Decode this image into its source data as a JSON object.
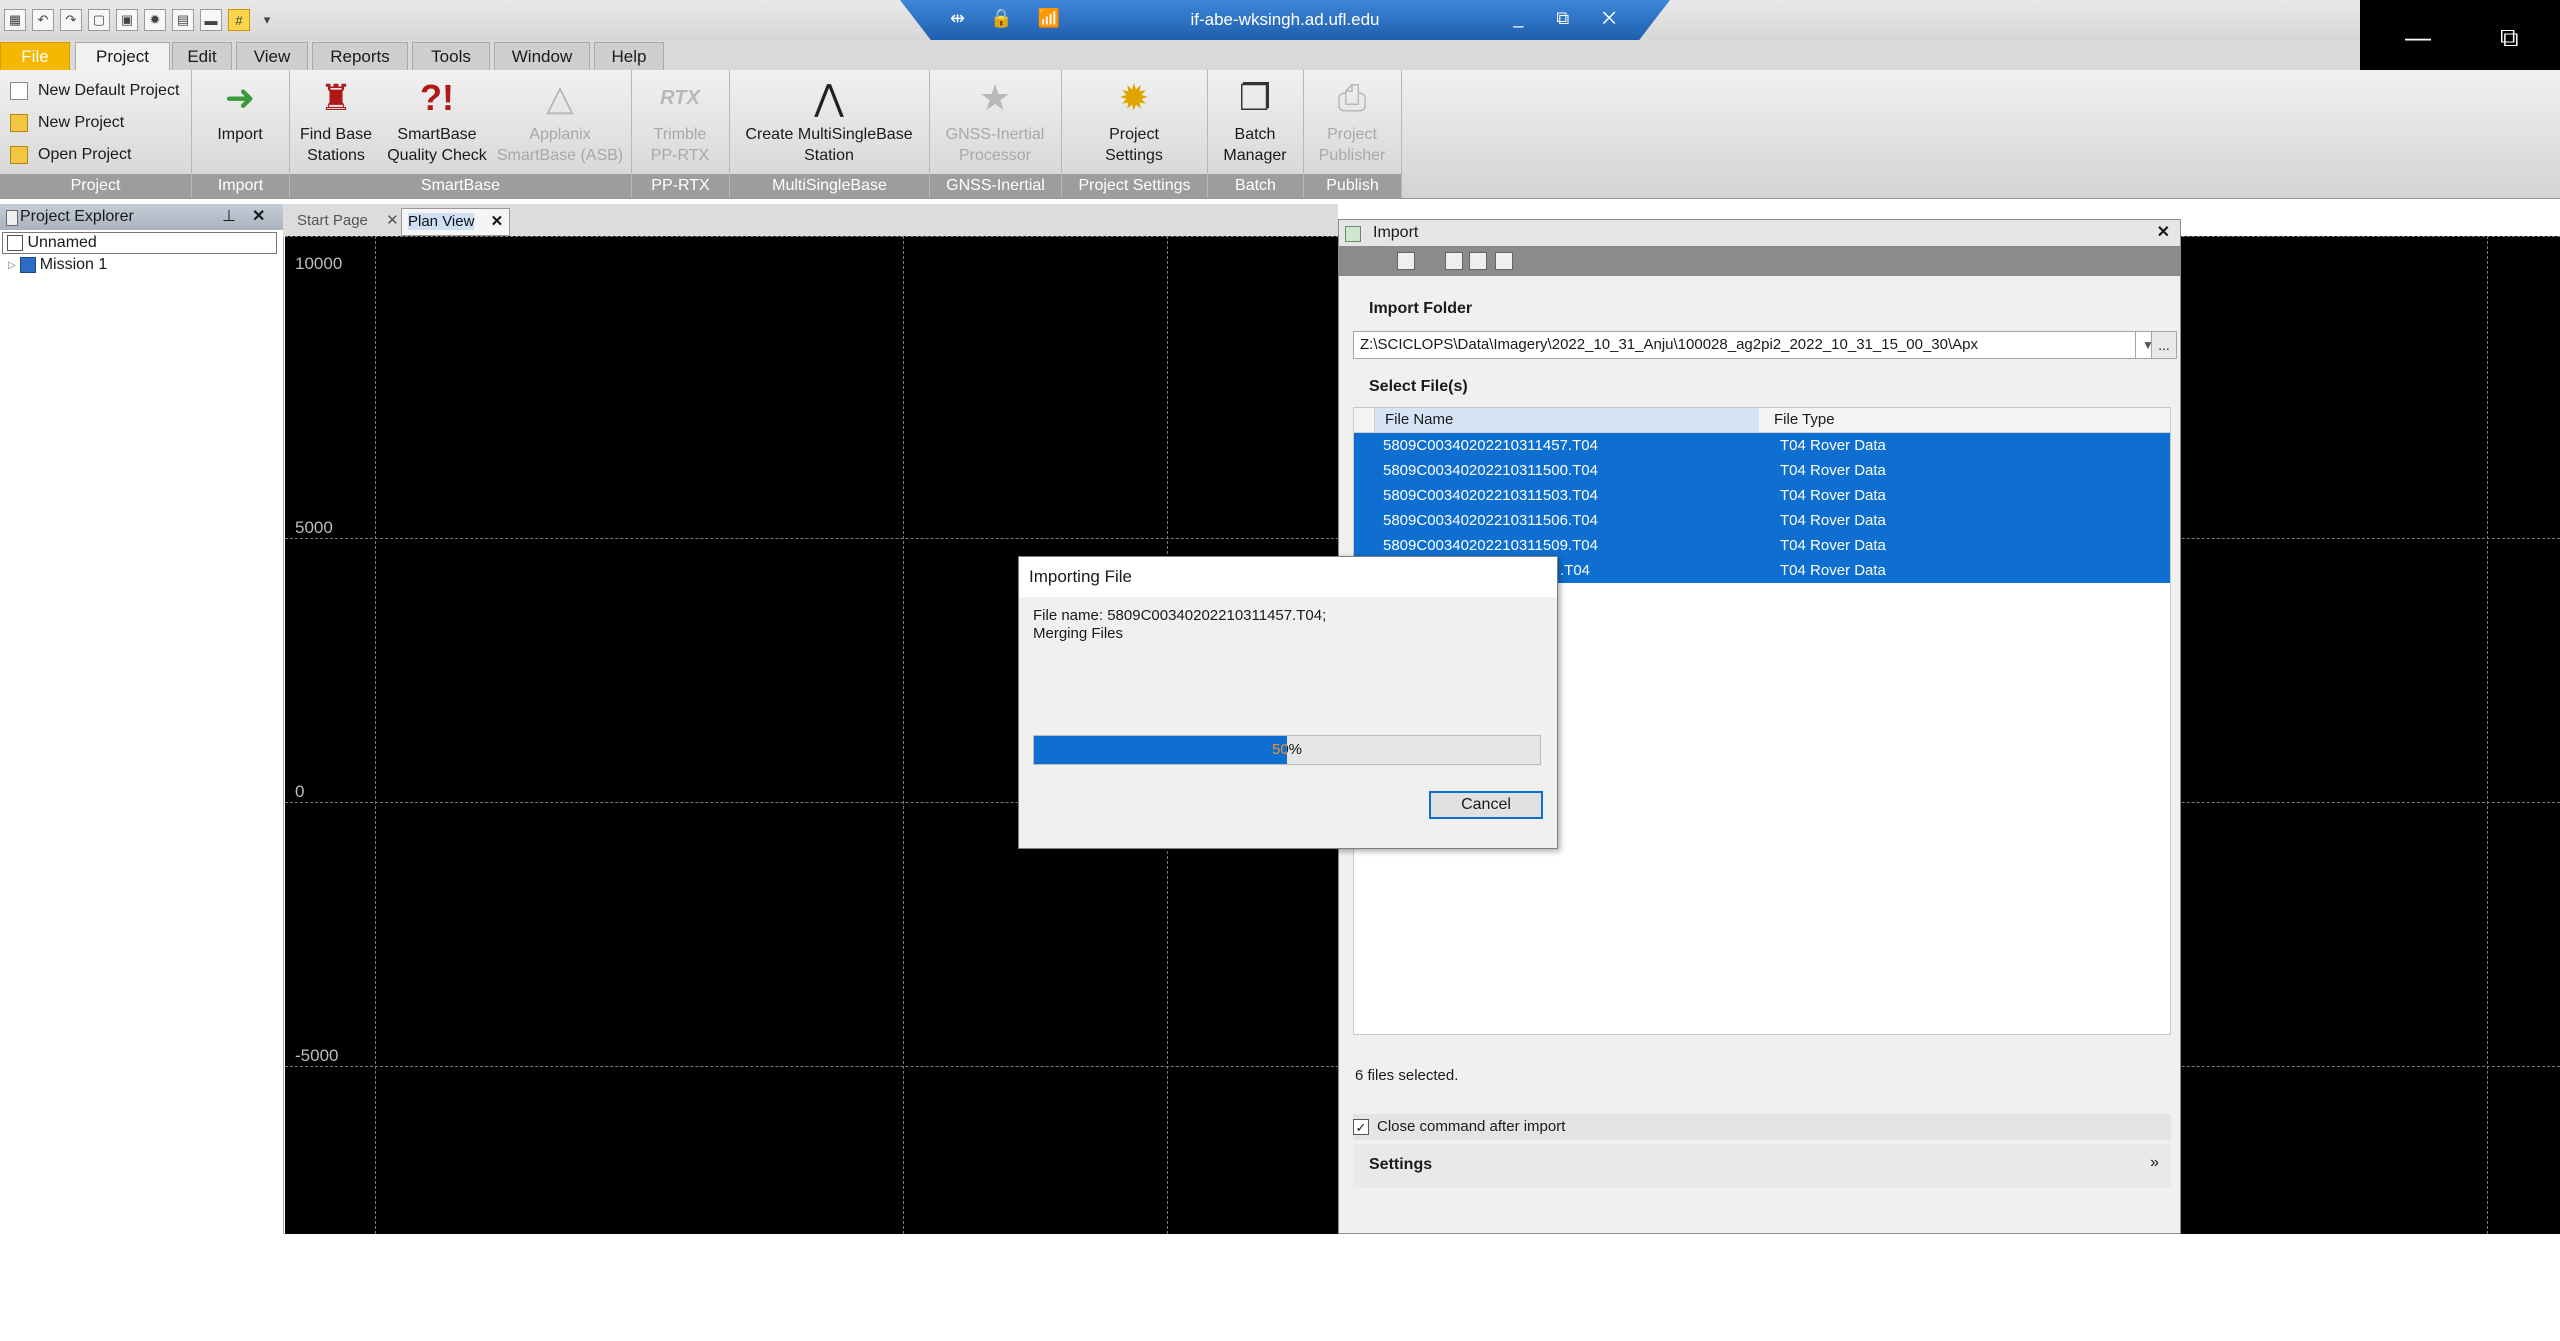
{
  "window": {
    "remote_host": "if-abe-wksingh.ad.ufl.edu",
    "remote_left_icons": "⇹ 🔒 📶",
    "remote_right_icons": "_ ⧉ ✕"
  },
  "menu": {
    "tabs": [
      "File",
      "Project",
      "Edit",
      "View",
      "Reports",
      "Tools",
      "Window",
      "Help"
    ]
  },
  "ribbon": {
    "project_group": {
      "items": [
        "New Default Project",
        "New Project",
        "Open Project"
      ],
      "label": "Project"
    },
    "import_group": {
      "button": "Import",
      "label": "Import"
    },
    "smartbase_group": {
      "find_base_1": "Find Base",
      "find_base_2": "Stations",
      "qc_1": "SmartBase",
      "qc_2": "Quality Check",
      "asb_1": "Applanix",
      "asb_2": "SmartBase (ASB)",
      "label": "SmartBase"
    },
    "pprtx_group": {
      "b1": "Trimble",
      "b2": "PP-RTX",
      "label": "PP-RTX",
      "icon_text": "RTX"
    },
    "msb_group": {
      "b1": "Create MultiSingleBase",
      "b2": "Station",
      "label": "MultiSingleBase"
    },
    "gnss_group": {
      "b1": "GNSS-Inertial",
      "b2": "Processor",
      "label": "GNSS-Inertial"
    },
    "settings_group": {
      "b1": "Project",
      "b2": "Settings",
      "label": "Project Settings"
    },
    "batch_group": {
      "b1": "Batch",
      "b2": "Manager",
      "label": "Batch"
    },
    "publish_group": {
      "b1": "Project",
      "b2": "Publisher",
      "label": "Publish"
    }
  },
  "explorer": {
    "title": "Project Explorer",
    "root": "Unnamed",
    "child": "Mission 1"
  },
  "doctabs": {
    "tab1": "Start Page",
    "tab2": "Plan View"
  },
  "plan": {
    "y_labels": [
      "10000",
      "5000",
      "0",
      "-5000"
    ]
  },
  "import": {
    "title": "Import",
    "folder_label": "Import Folder",
    "folder_path": "Z:\\SCICLOPS\\Data\\Imagery\\2022_10_31_Anju\\100028_ag2pi2_2022_10_31_15_00_30\\Apx",
    "browse": "...",
    "files_label": "Select File(s)",
    "col_name": "File Name",
    "col_type": "File Type",
    "rows": [
      {
        "name": "5809C00340202210311457.T04",
        "type": "T04 Rover Data"
      },
      {
        "name": "5809C00340202210311500.T04",
        "type": "T04 Rover Data"
      },
      {
        "name": "5809C00340202210311503.T04",
        "type": "T04 Rover Data"
      },
      {
        "name": "5809C00340202210311506.T04",
        "type": "T04 Rover Data"
      },
      {
        "name": "5809C00340202210311509.T04",
        "type": "T04 Rover Data"
      },
      {
        "name": ".T04",
        "type": "T04 Rover Data"
      }
    ],
    "selected_count": "6 files selected.",
    "close_after": "Close command after import",
    "settings": "Settings"
  },
  "dialog": {
    "title": "Importing File",
    "line1": "File name: 5809C00340202210311457.T04;",
    "line2": "Merging Files",
    "progress_label": "50%",
    "progress_fraction": 0.5,
    "cancel": "Cancel"
  }
}
